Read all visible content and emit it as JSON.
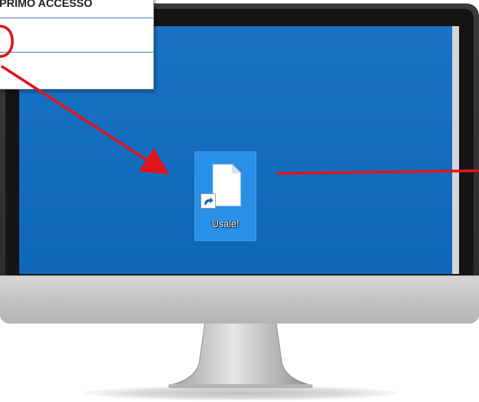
{
  "login_panel": {
    "title": "PRIMO ACCESSO"
  },
  "desktop": {
    "background_color": "#0e6cc2",
    "icon": {
      "label": "Usale!",
      "icon_name": "shortcut-file-icon"
    }
  },
  "annotations": {
    "color": "#e0151b",
    "items": [
      "circle-highlight",
      "arrow-to-icon",
      "line-from-icon"
    ]
  }
}
